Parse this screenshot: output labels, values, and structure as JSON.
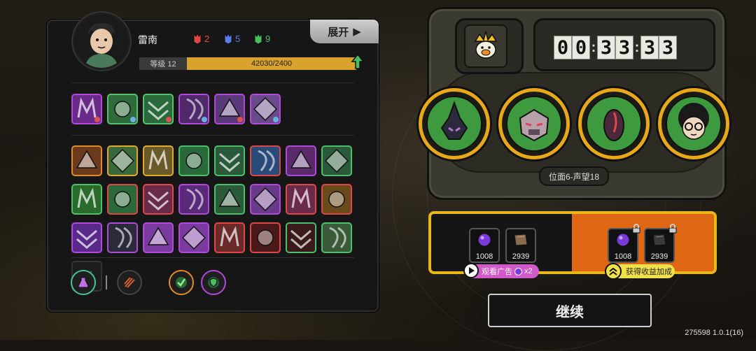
{
  "player": {
    "name": "雷南",
    "level_label": "等级 12",
    "xp_text": "42030/2400",
    "xp_progress": 1.0
  },
  "resources": [
    {
      "icon": "red-gem-icon",
      "count": "2",
      "color": "#e04848"
    },
    {
      "icon": "blue-gem-icon",
      "count": "5",
      "color": "#5a7ce8"
    },
    {
      "icon": "green-gem-icon",
      "count": "9",
      "color": "#48c060"
    }
  ],
  "expand_label": "展开",
  "equipped_skills": [
    {
      "icon": "claw-skill-icon",
      "border": "#b04ad8",
      "bg": "#6a2a8a"
    },
    {
      "icon": "burst-skill-icon",
      "border": "#58c070",
      "bg": "#2e6b3a"
    },
    {
      "icon": "tree-skill-icon",
      "border": "#58c070",
      "bg": "#2a6a3a"
    },
    {
      "icon": "cannon-skill-icon",
      "border": "#b04ad8",
      "bg": "#4e2a6a"
    },
    {
      "icon": "machine-skill-icon",
      "border": "#b04ad8",
      "bg": "#5a3a7a"
    },
    {
      "icon": "robot-skill-icon",
      "border": "#b04ad8",
      "bg": "#6a4a8a"
    }
  ],
  "skill_grid": [
    {
      "icon": "gate-icon",
      "border": "#e08a2c",
      "bg": "#6a3a1a"
    },
    {
      "icon": "vines-icon",
      "border": "#e0a82c",
      "bg": "#3a6a3a"
    },
    {
      "icon": "sunrise-icon",
      "border": "#e0a82c",
      "bg": "#6a5a2a"
    },
    {
      "icon": "diamond-icon",
      "border": "#4ac06a",
      "bg": "#2a6a3a"
    },
    {
      "icon": "arrows-icon",
      "border": "#4ac06a",
      "bg": "#2a5a3a"
    },
    {
      "icon": "shuriken-icon",
      "border": "#e04848",
      "bg": "#2a4a7a"
    },
    {
      "icon": "slash-icon",
      "border": "#b04ad8",
      "bg": "#5a2a6a"
    },
    {
      "icon": "hooded-figure-icon",
      "border": "#4ac06a",
      "bg": "#2a5a3a"
    },
    {
      "icon": "chevron-icon",
      "border": "#4ac06a",
      "bg": "#2a6a2a"
    },
    {
      "icon": "spikes-icon",
      "border": "#e04848",
      "bg": "#2a6a3a"
    },
    {
      "icon": "flame-icon",
      "border": "#e04848",
      "bg": "#6a2a4a"
    },
    {
      "icon": "crystal-icon",
      "border": "#b04ad8",
      "bg": "#5a2a7a"
    },
    {
      "icon": "lightning-icon",
      "border": "#4ac06a",
      "bg": "#2a5a3a"
    },
    {
      "icon": "tentacle-icon",
      "border": "#b04ad8",
      "bg": "#6a3a8a"
    },
    {
      "icon": "blades-icon",
      "border": "#e04848",
      "bg": "#6a2a4a"
    },
    {
      "icon": "tree-burst-icon",
      "border": "#e04848",
      "bg": "#6a4a1a"
    },
    {
      "icon": "spiky-ball-icon",
      "border": "#b04ad8",
      "bg": "#5a2a8a"
    },
    {
      "icon": "dark-beast-icon",
      "border": "#b04ad8",
      "bg": "#2a2a3a"
    },
    {
      "icon": "claw-swipe-icon",
      "border": "#b04ad8",
      "bg": "#7a3aa0"
    },
    {
      "icon": "goo-icon",
      "border": "#b04ad8",
      "bg": "#7a3aa0"
    },
    {
      "icon": "red-claw-icon",
      "border": "#e04848",
      "bg": "#6a2a2a"
    },
    {
      "icon": "dragon-icon",
      "border": "#e04848",
      "bg": "#4a1a1a"
    },
    {
      "icon": "green-burst-icon",
      "border": "#4ac06a",
      "bg": "#3a1a1a"
    },
    {
      "icon": "totem-icon",
      "border": "#4ac06a",
      "bg": "#3a5a3a"
    },
    {
      "icon": "empty-slot-icon",
      "border": "#333333",
      "bg": "#1d1d1d",
      "empty": true
    }
  ],
  "bottom_icons": [
    {
      "icon": "potion-icon",
      "border": "#48c0a0"
    },
    {
      "icon": "scratch-icon",
      "border": "#444444"
    },
    {
      "icon": "checkmark-orb-icon",
      "border": "#e08a2c"
    },
    {
      "icon": "shield-orb-icon",
      "border": "#b04ad8"
    }
  ],
  "timer": [
    "0",
    "0",
    "3",
    "3",
    "3",
    "3"
  ],
  "heroes": [
    {
      "icon": "dark-crystal-hero-icon"
    },
    {
      "icon": "mech-hero-icon"
    },
    {
      "icon": "pod-hero-icon"
    },
    {
      "icon": "glasses-kid-hero-icon"
    }
  ],
  "stage_label": "位面6-声望18",
  "rewards": {
    "base": [
      {
        "icon": "purple-orb-icon",
        "value": "1008"
      },
      {
        "icon": "book-icon",
        "value": "2939"
      }
    ],
    "bonus": [
      {
        "icon": "purple-orb-icon",
        "value": "1008"
      },
      {
        "icon": "book-icon",
        "value": "2939"
      }
    ]
  },
  "ad_button_label": "观看广告",
  "ad_multiplier": "x2",
  "bonus_button_label": "获得收益加成",
  "continue_label": "继续",
  "version": "275598 1.0.1(16)",
  "colors": {
    "accent_gold": "#e8b818",
    "orange": "#e06814",
    "ad_pink": "#d25ac8"
  }
}
